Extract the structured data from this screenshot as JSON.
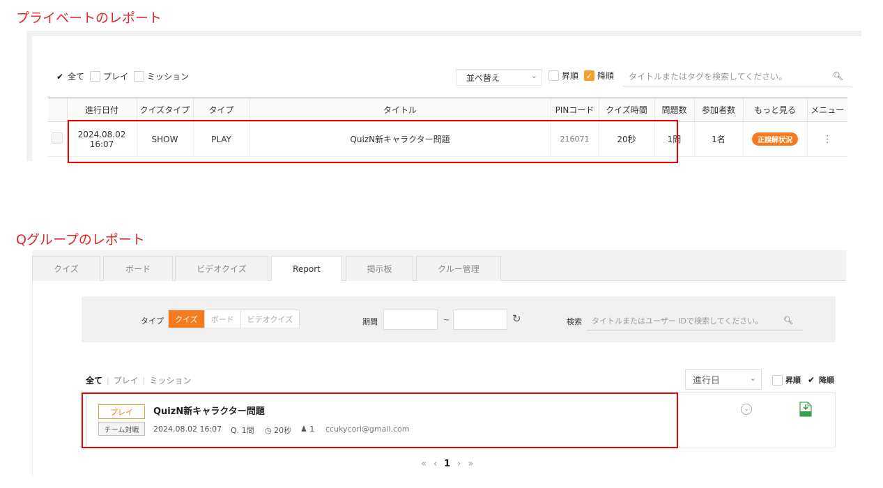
{
  "section1": {
    "heading": "プライベートのレポート",
    "filters": [
      {
        "label": "全て",
        "checked": true
      },
      {
        "label": "プレイ",
        "checked": false
      },
      {
        "label": "ミッション",
        "checked": false
      }
    ],
    "sort": {
      "label": "並べ替え"
    },
    "order": {
      "asc_label": "昇順",
      "desc_label": "降順"
    },
    "search": {
      "placeholder": "タイトルまたはタグを検索してください。"
    },
    "table": {
      "headers": [
        "進行日付",
        "クイズタイプ",
        "タイプ",
        "タイトル",
        "PINコード",
        "クイズ時間",
        "問題数",
        "参加者数",
        "もっと見る",
        "メニュー"
      ],
      "row": {
        "date": "2024.08.02",
        "time": "16:07",
        "quiz_type": "SHOW",
        "type": "PLAY",
        "title": "QuizN新キャラクター問題",
        "pin": "216071",
        "quiz_time": "20秒",
        "questions": "1問",
        "participants": "1名",
        "more_label": "正誤解状況",
        "menu_icon": "⋮"
      }
    }
  },
  "section2": {
    "heading": "Qグループのレポート",
    "tabs": [
      "クイズ",
      "ボード",
      "ビデオクイズ",
      "Report",
      "掲示板",
      "クルー管理"
    ],
    "active_tab": "Report",
    "filter": {
      "type_label": "タイプ",
      "type_options": [
        "クイズ",
        "ボード",
        "ビデオクイズ"
      ],
      "period_label": "期間",
      "tilde": "~",
      "search_label": "検索",
      "search_placeholder": "タイトルまたはユーザー IDで検索してください。"
    },
    "list_tabs": [
      "全て",
      "プレイ",
      "ミッション"
    ],
    "sort_label": "進行日",
    "order": {
      "asc_label": "昇順",
      "desc_label": "降順"
    },
    "card": {
      "tag": "プレイ",
      "title": "QuizN新キャラクター問題",
      "team_tag": "チーム対戦",
      "datetime": "2024.08.02 16:07",
      "questions": "1問",
      "time": "20秒",
      "participants": "1",
      "email": "ccukycori@gmail.com"
    },
    "pager": {
      "first": "«",
      "prev": "‹",
      "current": "1",
      "next": "›",
      "last": "»"
    }
  },
  "colors": {
    "heading_red": "#e0262b",
    "accent_orange": "#f47c1e",
    "highlight_red": "#ee0000"
  }
}
